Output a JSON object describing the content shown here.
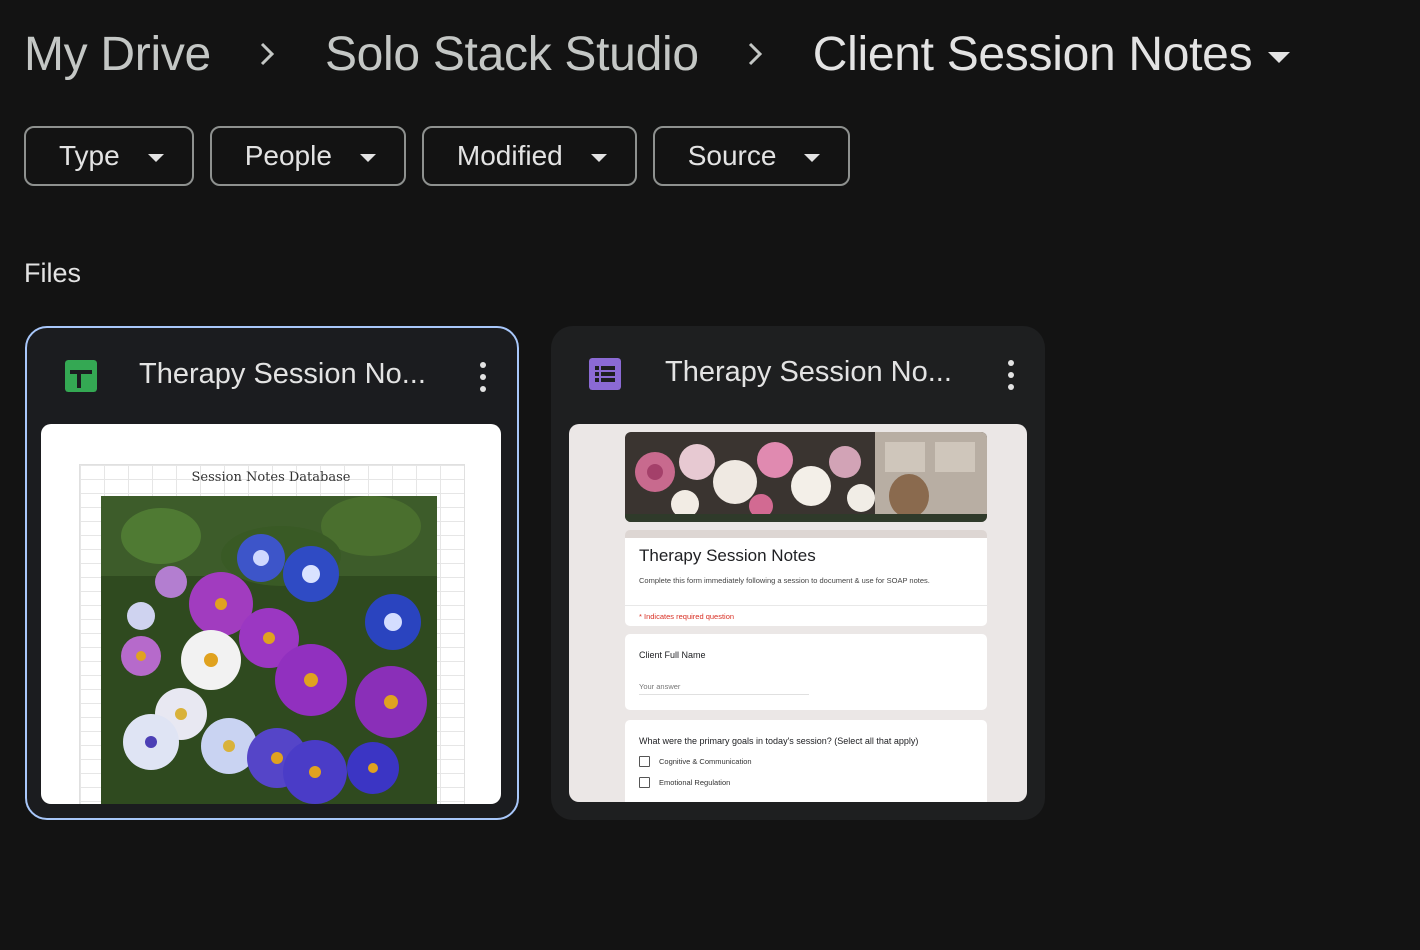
{
  "breadcrumb": {
    "items": [
      "My Drive",
      "Solo Stack Studio",
      "Client Session Notes"
    ]
  },
  "filters": [
    "Type",
    "People",
    "Modified",
    "Source"
  ],
  "section_title": "Files",
  "files": [
    {
      "title": "Therapy Session No...",
      "icon": "google-sheets-icon",
      "icon_color": "#34a853",
      "selected": true,
      "preview_title": "Session Notes Database"
    },
    {
      "title": "Therapy Session No...",
      "icon": "google-forms-icon",
      "icon_color": "#7c5dc7",
      "selected": false,
      "preview": {
        "title": "Therapy Session Notes",
        "description": "Complete this form immediately following a session to document & use for SOAP notes.",
        "required_note": "* Indicates required question",
        "q1_label": "Client Full Name",
        "q1_placeholder": "Your answer",
        "q2_label": "What were the primary goals in today's session? (Select all that apply)",
        "q2_options": [
          "Cognitive & Communication",
          "Emotional Regulation"
        ]
      }
    }
  ],
  "colors": {
    "background": "#131313",
    "card": "#1e1f20",
    "selected_border": "#a8c7fa",
    "chip_border": "#8e918f"
  }
}
